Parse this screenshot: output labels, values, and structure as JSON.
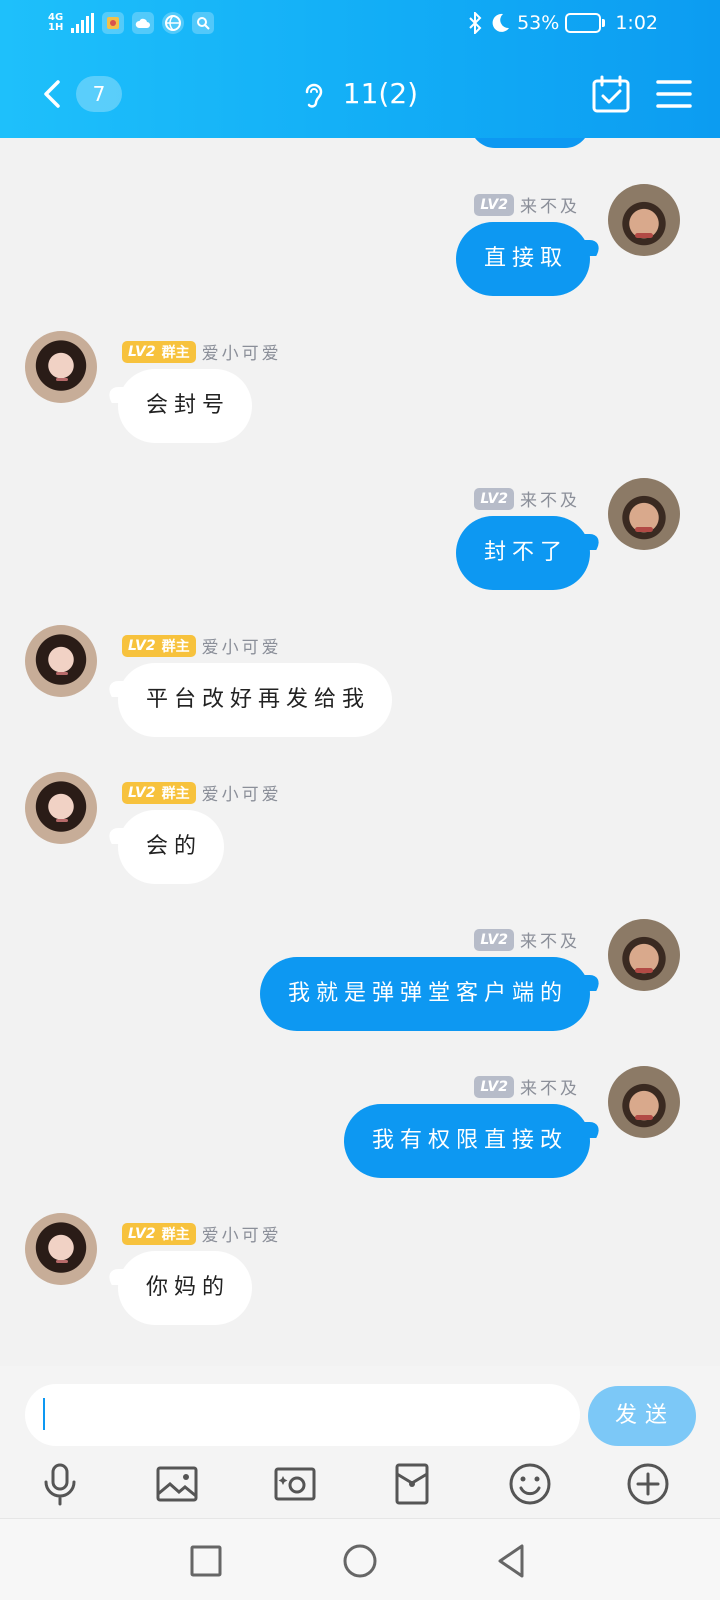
{
  "status_bar": {
    "network": "4G",
    "network_sub": "1H",
    "battery": "53%",
    "battery_level": 0.53,
    "time": "1:02",
    "icons": [
      "signal-icon",
      "app-icon",
      "cloud-icon",
      "browser-icon",
      "search-icon",
      "bluetooth-icon",
      "moon-icon",
      "battery-icon"
    ]
  },
  "header": {
    "unread_count": "7",
    "title": "11(2)",
    "icons": [
      "back-icon",
      "ear-icon",
      "calendar-check-icon",
      "menu-icon"
    ]
  },
  "messages": [
    {
      "side": "out",
      "level": "LV2",
      "role": "",
      "nick": "来不及",
      "text": "直接取"
    },
    {
      "side": "in",
      "level": "LV2",
      "role": "群主",
      "nick": "爱小可爱",
      "text": "会封号"
    },
    {
      "side": "out",
      "level": "LV2",
      "role": "",
      "nick": "来不及",
      "text": "封不了"
    },
    {
      "side": "in",
      "level": "LV2",
      "role": "群主",
      "nick": "爱小可爱",
      "text": "平台改好再发给我"
    },
    {
      "side": "in",
      "level": "LV2",
      "role": "群主",
      "nick": "爱小可爱",
      "text": "会的"
    },
    {
      "side": "out",
      "level": "LV2",
      "role": "",
      "nick": "来不及",
      "text": "我就是弹弹堂客户端的"
    },
    {
      "side": "out",
      "level": "LV2",
      "role": "",
      "nick": "来不及",
      "text": "我有权限直接改"
    },
    {
      "side": "in",
      "level": "LV2",
      "role": "群主",
      "nick": "爱小可爱",
      "text": "你妈的"
    }
  ],
  "composer": {
    "input_value": "",
    "send_label": "发送",
    "tools": [
      "microphone-icon",
      "image-icon",
      "camera-icon",
      "red-envelope-icon",
      "emoji-icon",
      "plus-icon"
    ]
  },
  "system_nav": [
    "recents-icon",
    "home-icon",
    "back-icon"
  ],
  "colors": {
    "header": "#12adf6",
    "outgoing_bubble": "#0d98f2",
    "send_button": "#7cc8f7",
    "level_badge": "#b7bcc9",
    "owner_badge": "#f7c23d"
  }
}
